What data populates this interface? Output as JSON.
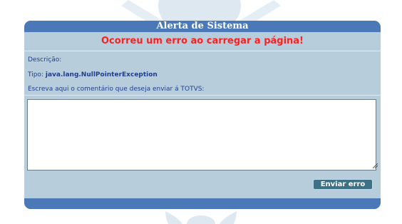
{
  "alert": {
    "title": "Alerta de Sistema",
    "error_message": "Ocorreu um erro ao carregar a página!",
    "description_label": "Descrição:",
    "type_label": "Tipo:",
    "type_value": "java.lang.NullPointerException",
    "comment_prompt": "Escreva aqui o comentário que deseja enviar á TOTVS:",
    "comment_value": "",
    "send_button": "Enviar erro"
  },
  "colors": {
    "header": "#4b79b8",
    "panel": "#b8cddc",
    "error_text": "#ff1f1f",
    "label_text": "#1f3f86",
    "button": "#3d7186"
  }
}
